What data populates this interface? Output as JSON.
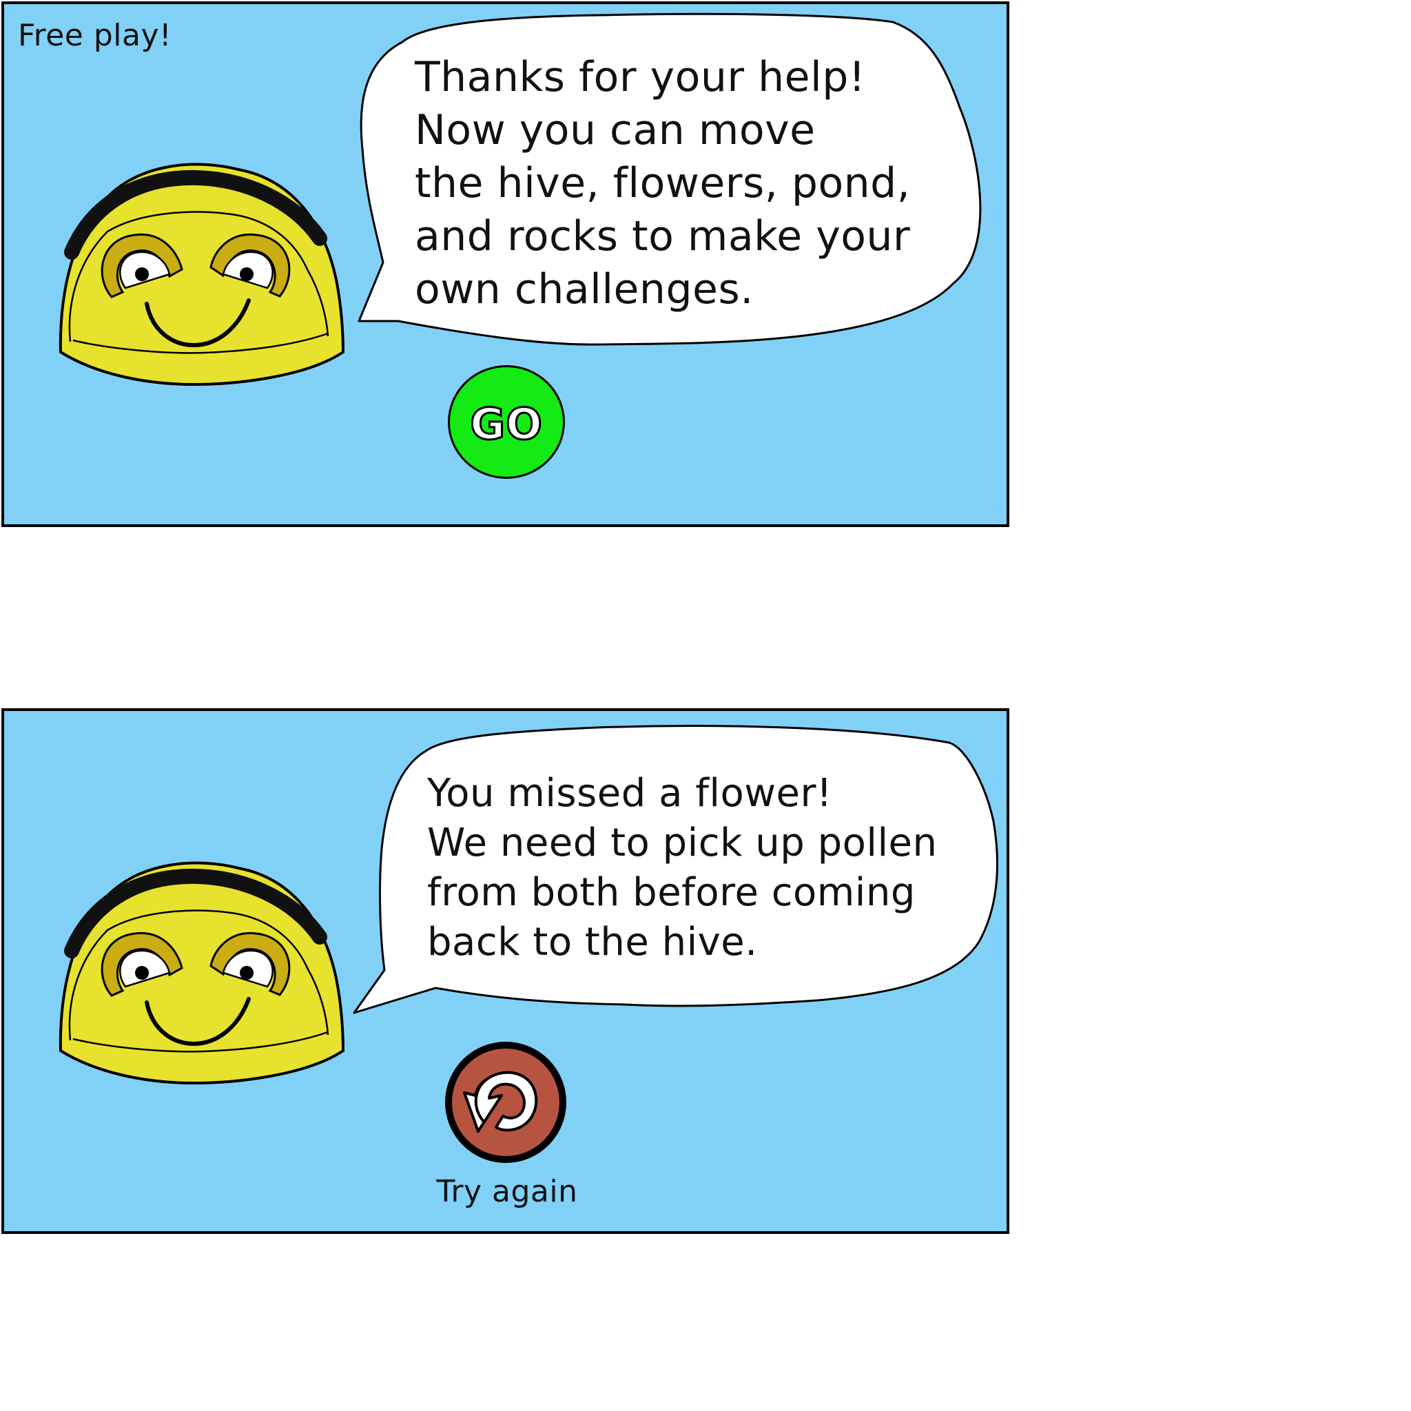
{
  "colors": {
    "panel_background": "#81d1f6",
    "bee_body": "#e6e22e",
    "bee_stripe": "#111111",
    "eye_ring": "#c9ad12",
    "go_button": "#14ea14",
    "retry_button": "#b75441",
    "bubble": "#ffffff"
  },
  "panels": [
    {
      "tag": "Free play!",
      "character": "bee-bot-icon",
      "message": [
        "Thanks for your help!",
        "Now you can move",
        "the hive, flowers, pond,",
        "and rocks to make your",
        "own challenges."
      ],
      "button": {
        "label": "GO",
        "icon": "go-icon"
      }
    },
    {
      "tag": "",
      "character": "bee-bot-icon",
      "message": [
        "You missed a flower!",
        "We need to pick up pollen",
        "from both before coming",
        "back to the hive."
      ],
      "button": {
        "label": "Try again",
        "icon": "retry-arrow-icon"
      }
    }
  ]
}
